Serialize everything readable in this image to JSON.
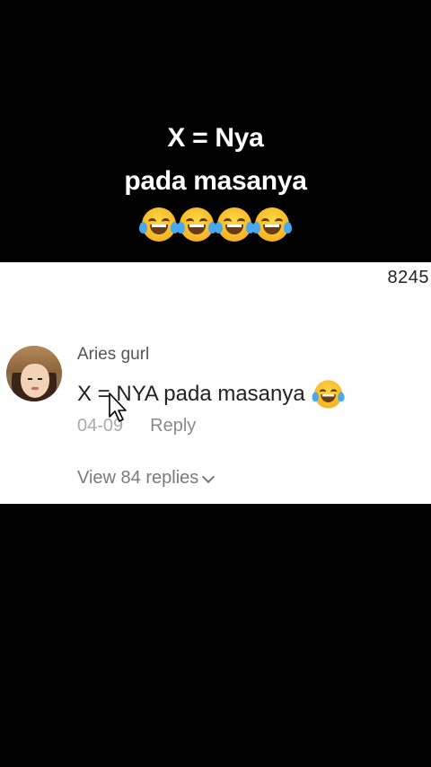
{
  "caption": {
    "line1": "X = Nya",
    "line2": "pada masanya",
    "emoji_count": 4,
    "emoji": "face-with-tears-of-joy"
  },
  "comment_panel": {
    "count": "8245",
    "comment": {
      "username": "Aries gurl",
      "text": "X = NYA pada masanya",
      "date": "04-09",
      "reply_label": "Reply",
      "view_replies_label": "View 84 replies"
    }
  },
  "colors": {
    "background": "#000000",
    "panel": "#ffffff",
    "caption_text": "#ffffff"
  }
}
